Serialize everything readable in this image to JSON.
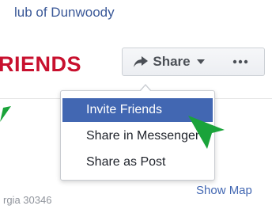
{
  "page": {
    "name_partial": "lub of Dunwoody"
  },
  "cover": {
    "heading_partial": "RIENDS"
  },
  "actions": {
    "share_label": "Share",
    "share_icon": "share-arrow-icon",
    "caret_icon": "chevron-down-icon",
    "more_icon": "more-dots-icon"
  },
  "share_menu": {
    "items": [
      {
        "label": "Invite Friends",
        "active": true
      },
      {
        "label": "Share in Messenger",
        "active": false
      },
      {
        "label": "Share as Post",
        "active": false
      }
    ]
  },
  "location": {
    "address_partial": "rgia 30346",
    "show_map_label": "Show Map"
  },
  "colors": {
    "link_blue": "#3b5998",
    "highlight_blue": "#4267b2",
    "heading_red": "#c8102e",
    "annotation_green": "#1aa33a"
  }
}
